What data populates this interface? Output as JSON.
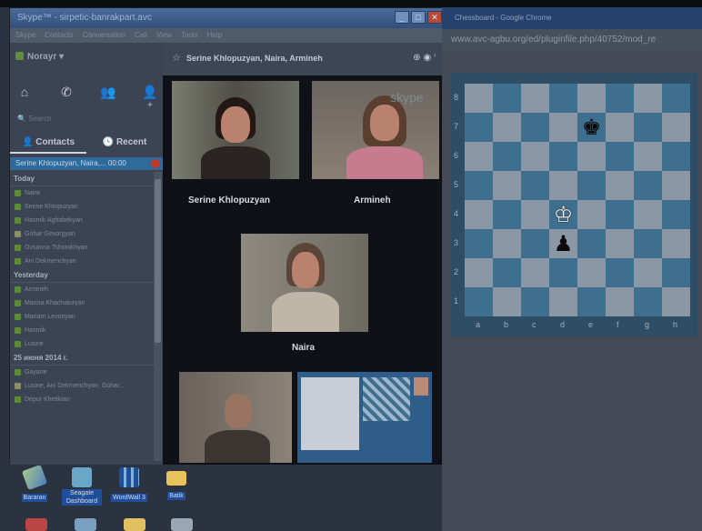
{
  "skype": {
    "title": "Skype™ - sirpetic-banrakpart.avc",
    "menu": [
      "Skype",
      "Contacts",
      "Conversation",
      "Call",
      "View",
      "Tools",
      "Help"
    ],
    "user": "Norayr",
    "search_placeholder": "Search",
    "tabs": {
      "contacts": "Contacts",
      "recent": "Recent"
    },
    "active_call": "Serine Khlopuzyan, Naira,...   00:00",
    "groups": [
      {
        "heading": "Today",
        "items": [
          "Naira",
          "Serine Khlopuzyan",
          "Hasmik Aghabekyan",
          "Gohar Gevorgyan",
          "Ovsanna Tshorokhyan",
          "Ani Dekmenchyan"
        ]
      },
      {
        "heading": "Yesterday",
        "items": [
          "Armineh",
          "Marina Khachaturyan",
          "Mariam Levonyan",
          "Hasmik",
          "Lusine"
        ]
      },
      {
        "heading": "25 июня 2014 г.",
        "items": [
          "Gayane",
          "Lusine, Ani Dekmenchyan, Gohar...",
          "Depur Khetikian"
        ]
      }
    ]
  },
  "call": {
    "title": "Serine Khlopuzyan, Naira, Armineh",
    "participants": {
      "p1": "Serine Khlopuzyan",
      "p2": "Armineh",
      "p3": "Naira"
    },
    "watermark": "skype"
  },
  "chrome": {
    "title": "Chessboard - Google Chrome",
    "url": "www.avc-agbu.org/ed/pluginfile.php/40752/mod_re"
  },
  "chess": {
    "ranks": [
      "8",
      "7",
      "6",
      "5",
      "4",
      "3",
      "2",
      "1"
    ],
    "files": [
      "a",
      "b",
      "c",
      "d",
      "e",
      "f",
      "g",
      "h"
    ],
    "pieces": [
      {
        "glyph": "♚",
        "square": "e7",
        "color": "black"
      },
      {
        "glyph": "♔",
        "square": "d4",
        "color": "white"
      },
      {
        "glyph": "♟",
        "square": "d3",
        "color": "black"
      }
    ]
  },
  "desktop": {
    "icons": [
      "Bararan",
      "Seagate Dashboard",
      "WordWall 3",
      "Batik"
    ]
  }
}
